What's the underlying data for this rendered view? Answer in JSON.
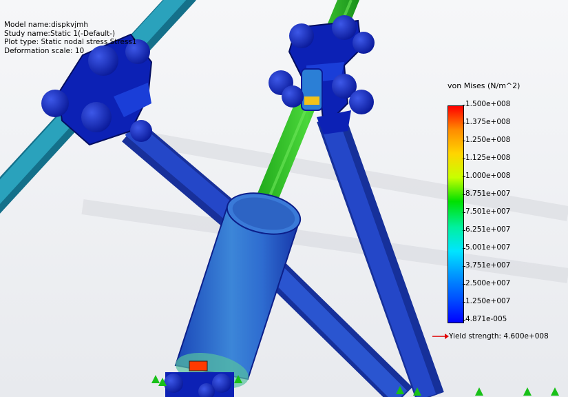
{
  "study_info": {
    "model_name": "Model name:dispkvjmh",
    "study_name": "Study name:Static 1(-Default-)",
    "plot_type": "Plot type: Static nodal stress Stress1",
    "deformation_scale": "Deformation scale: 10"
  },
  "legend": {
    "title": "von Mises (N/m^2)",
    "ticks": [
      "1.500e+008",
      "1.375e+008",
      "1.250e+008",
      "1.125e+008",
      "1.000e+008",
      "8.751e+007",
      "7.501e+007",
      "6.251e+007",
      "5.001e+007",
      "3.751e+007",
      "2.500e+007",
      "1.250e+007",
      "4.871e-005"
    ],
    "yield_label": "Yield strength: 4.600e+008",
    "colors": [
      "#ff0000",
      "#ff8c00",
      "#ffd500",
      "#c8ff00",
      "#00e000",
      "#00f0a0",
      "#00e5ff",
      "#0096ff",
      "#0050ff",
      "#0000ff"
    ]
  },
  "scene_colors": {
    "background": "#f2f3f5",
    "tube_teal": "#1f8fa8",
    "tube_green": "#2fc21f",
    "strut_blue": "#1d3bb5",
    "clamp_blue": "#0b1fb0",
    "cylinder_blue": "#2f63cc",
    "arrow_red": "#e00000"
  }
}
